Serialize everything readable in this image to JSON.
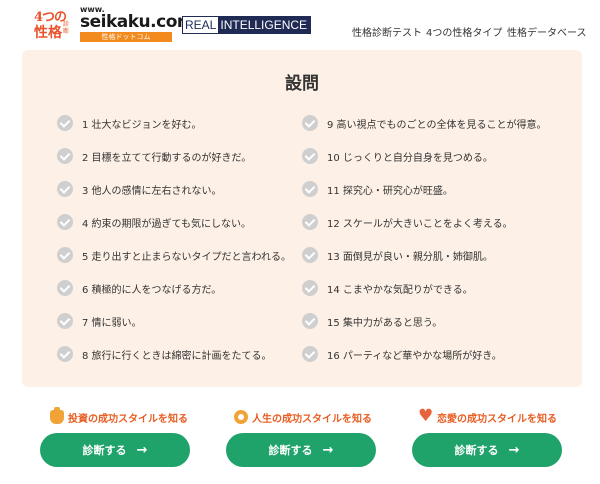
{
  "header": {
    "logo_top": "4つの",
    "logo_bottom": "性格",
    "logo_side": "診断",
    "seikaku_www": "www.",
    "seikaku_domain": "seikaku.com",
    "seikaku_kana": "性格ドットコム",
    "real_left": "REAL",
    "real_right": "INTELLIGENCE",
    "nav": [
      "性格診断テスト",
      "4つの性格タイプ",
      "性格データベース"
    ]
  },
  "questions": {
    "title": "設問",
    "left": [
      "1  壮大なビジョンを好む。",
      "2  目標を立てて行動するのが好きだ。",
      "3  他人の感情に左右されない。",
      "4  約束の期限が過ぎても気にしない。",
      "5  走り出すと止まらないタイプだと言われる。",
      "6  積極的に人をつなげる方だ。",
      "7  情に弱い。",
      "8  旅行に行くときは綿密に計画をたてる。"
    ],
    "right": [
      "9  高い視点でものごとの全体を見ることが得意。",
      "10 じっくりと自分自身を見つめる。",
      "11 探究心・研究心が旺盛。",
      "12 スケールが大きいことをよく考える。",
      "13 面倒見が良い・親分肌・姉御肌。",
      "14 こまやかな気配りができる。",
      "15 集中力があると思う。",
      "16 パーティなど華やかな場所が好き。"
    ]
  },
  "cta": [
    {
      "label": "投資の成功スタイルを知る",
      "icon": "money-bag-icon",
      "button": "診断する",
      "arrow": "→"
    },
    {
      "label": "人生の成功スタイルを知る",
      "icon": "lightbulb-icon",
      "button": "診断する",
      "arrow": "→"
    },
    {
      "label": "恋愛の成功スタイルを知る",
      "icon": "heart-icon",
      "button": "診断する",
      "arrow": "→"
    }
  ],
  "colors": {
    "accent_orange": "#e85d22",
    "button_green": "#20a36b",
    "card_bg": "#fdf0e6",
    "check_gray": "#cfcfcf"
  }
}
